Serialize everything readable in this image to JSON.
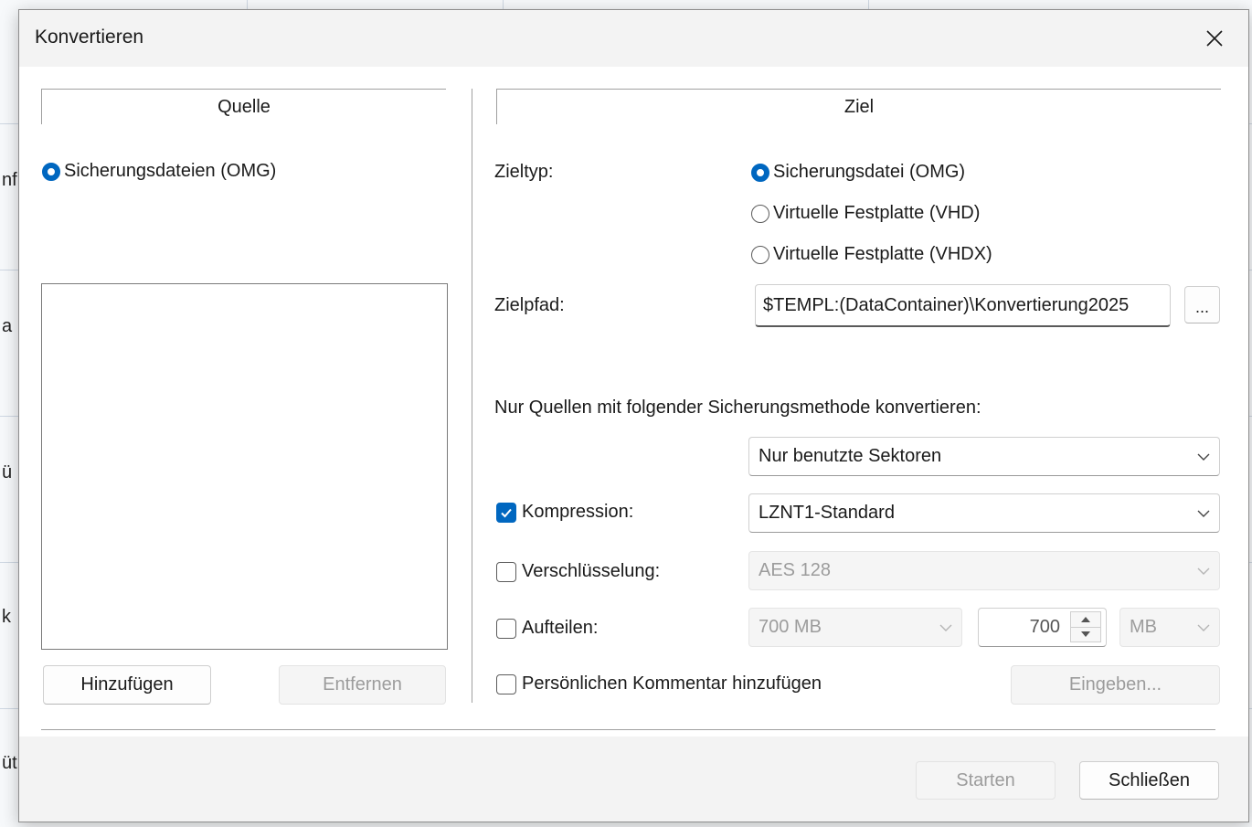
{
  "dialog": {
    "title": "Konvertieren",
    "close_glyph": "✕"
  },
  "background": {
    "fragments": [
      "nf",
      "a",
      "ü",
      "k",
      "üt"
    ]
  },
  "source": {
    "header": "Quelle",
    "radio_label": "Sicherungsdateien (OMG)",
    "radio_selected": true,
    "add_button": "Hinzufügen",
    "remove_button": "Entfernen"
  },
  "target": {
    "header": "Ziel",
    "type_label": "Zieltyp:",
    "type_options": [
      {
        "label": "Sicherungsdatei (OMG)",
        "selected": true
      },
      {
        "label": "Virtuelle Festplatte (VHD)",
        "selected": false
      },
      {
        "label": "Virtuelle Festplatte (VHDX)",
        "selected": false
      }
    ],
    "path_label": "Zielpfad:",
    "path_value": "$TEMPL:(DataContainer)\\Konvertierung2025",
    "browse_button": "...",
    "method_text": "Nur Quellen mit folgender Sicherungsmethode konvertieren:",
    "method_value": "Nur benutzte Sektoren",
    "compression": {
      "label": "Kompression:",
      "checked": true,
      "value": "LZNT1-Standard"
    },
    "encryption": {
      "label": "Verschlüsselung:",
      "checked": false,
      "value": "AES 128"
    },
    "split": {
      "label": "Aufteilen:",
      "checked": false,
      "preset": "700 MB",
      "amount": "700",
      "unit": "MB"
    },
    "comment": {
      "label": "Persönlichen Kommentar hinzufügen",
      "checked": false,
      "button": "Eingeben..."
    }
  },
  "footer": {
    "start_button": "Starten",
    "close_button": "Schließen"
  },
  "colors": {
    "accent": "#0067c0",
    "chrome": "#f3f3f3",
    "disabled_text": "#9c9c9c"
  },
  "icons": {
    "close": "close-icon",
    "dropdown": "chevron-down-icon",
    "spin_up": "spin-up-icon",
    "spin_down": "spin-down-icon",
    "check": "checkmark-icon"
  }
}
